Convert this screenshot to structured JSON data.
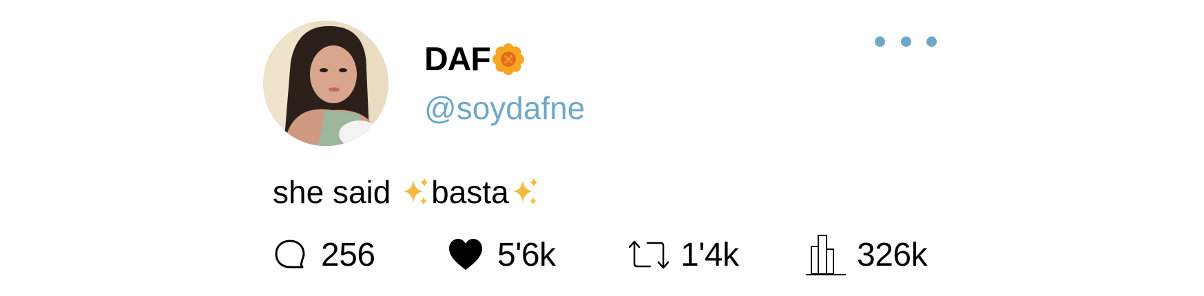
{
  "tweet": {
    "display_name": "DAF",
    "handle": "@soydafne",
    "text_part1": "she said ",
    "text_part2": "basta"
  },
  "metrics": {
    "replies": "256",
    "likes": "5'6k",
    "retweets": "1'4k",
    "views": "326k"
  },
  "icons": {
    "name_badge": "flower-icon",
    "text_emoji": "sparkles-icon",
    "reply": "speech-bubble-icon",
    "like": "heart-icon",
    "retweet": "retweet-icon",
    "views": "bar-chart-icon",
    "more": "more-dots-icon"
  },
  "colors": {
    "handle": "#6fa7c9",
    "more_dots": "#6fa7c9",
    "sparkle": "#f5b93d",
    "flower_outer": "#f6a623",
    "flower_inner": "#e8691c"
  }
}
